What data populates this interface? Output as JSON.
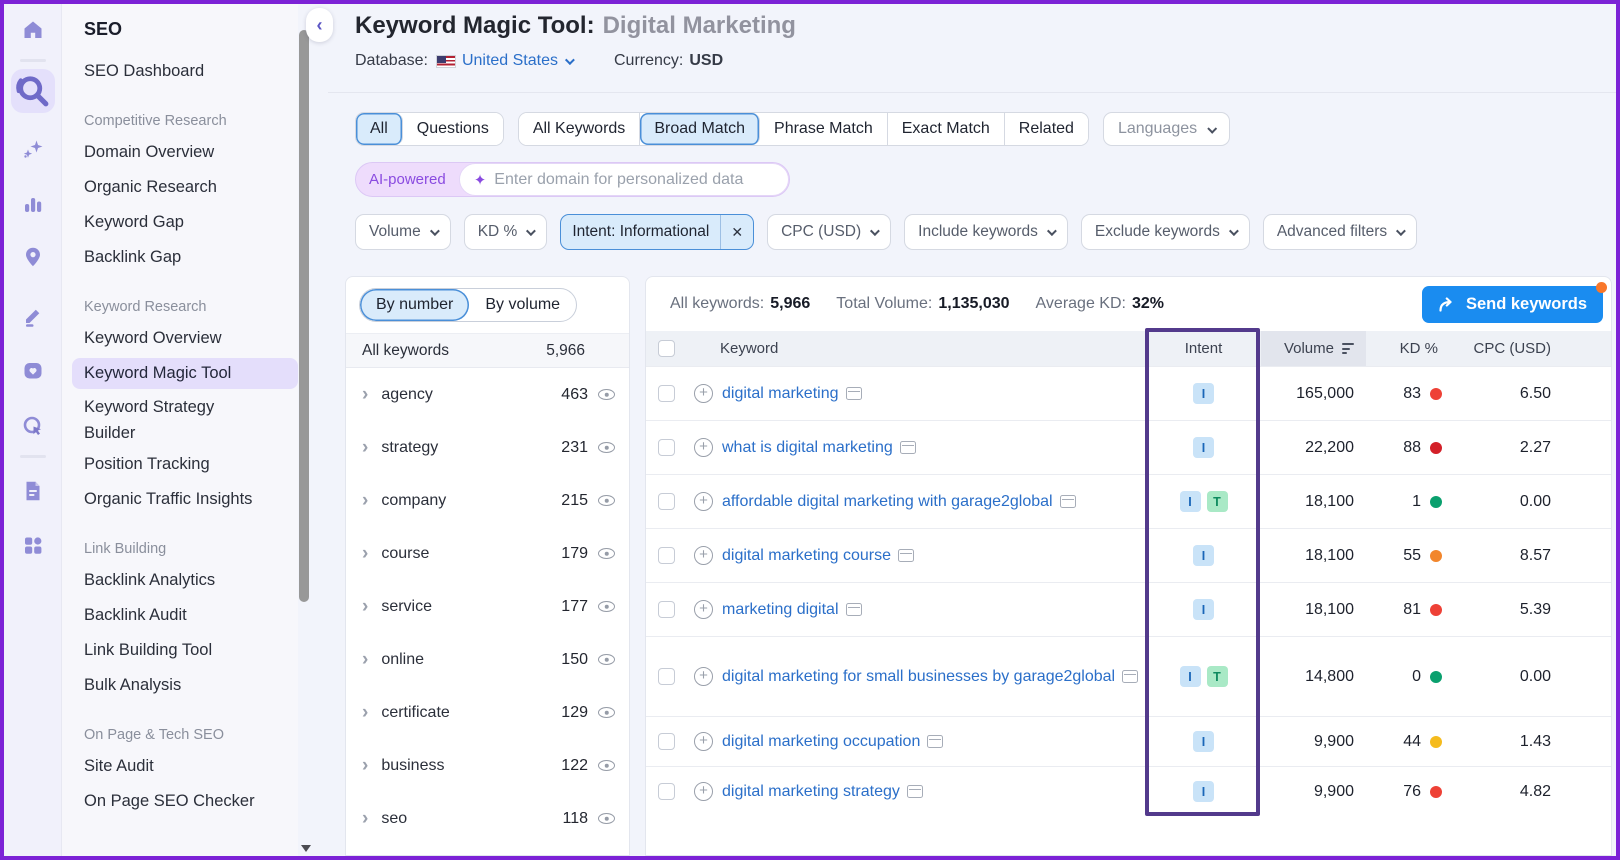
{
  "icons": {
    "plus": "+",
    "close": "✕",
    "chevron_right": "›",
    "chevron_left": "‹",
    "sparkle": "✦"
  },
  "rail": {
    "icons": [
      "home-icon",
      "seo-search-icon",
      "ai-sparkles-icon",
      "analytics-bars-icon",
      "local-pin-icon",
      "content-pencil-icon",
      "social-heart-icon",
      "advertising-target-icon",
      "reports-file-icon",
      "apps-grid-icon"
    ]
  },
  "sidebar": {
    "heading": "SEO",
    "dashboard": "SEO Dashboard",
    "sections": [
      {
        "title": "Competitive Research",
        "items": [
          "Domain Overview",
          "Organic Research",
          "Keyword Gap",
          "Backlink Gap"
        ]
      },
      {
        "title": "Keyword Research",
        "items": [
          "Keyword Overview",
          "Keyword Magic Tool",
          "Keyword Strategy Builder",
          "Position Tracking",
          "Organic Traffic Insights"
        ]
      },
      {
        "title": "Link Building",
        "items": [
          "Backlink Analytics",
          "Backlink Audit",
          "Link Building Tool",
          "Bulk Analysis"
        ]
      },
      {
        "title": "On Page & Tech SEO",
        "items": [
          "Site Audit",
          "On Page SEO Checker"
        ]
      }
    ],
    "active_item": "Keyword Magic Tool"
  },
  "header": {
    "title": "Keyword Magic Tool:",
    "query": "Digital Marketing",
    "database_label": "Database:",
    "database_value": "United States",
    "currency_label": "Currency:",
    "currency_value": "USD"
  },
  "tabs": {
    "scope": [
      "All",
      "Questions"
    ],
    "scope_active": "All",
    "match": [
      "All Keywords",
      "Broad Match",
      "Phrase Match",
      "Exact Match",
      "Related"
    ],
    "match_active": "Broad Match",
    "languages": "Languages"
  },
  "ai_bar": {
    "badge": "AI-powered",
    "placeholder": "Enter domain for personalized data"
  },
  "filters": {
    "volume": "Volume",
    "kd": "KD %",
    "intent_chip": "Intent: Informational",
    "cpc": "CPC (USD)",
    "include": "Include keywords",
    "exclude": "Exclude keywords",
    "advanced": "Advanced filters"
  },
  "groups_panel": {
    "toggle": [
      "By number",
      "By volume"
    ],
    "toggle_active": "By number",
    "header": {
      "label": "All keywords",
      "count": "5,966"
    },
    "items": [
      {
        "name": "agency",
        "count": "463"
      },
      {
        "name": "strategy",
        "count": "231"
      },
      {
        "name": "company",
        "count": "215"
      },
      {
        "name": "course",
        "count": "179"
      },
      {
        "name": "service",
        "count": "177"
      },
      {
        "name": "online",
        "count": "150"
      },
      {
        "name": "certificate",
        "count": "129"
      },
      {
        "name": "business",
        "count": "122"
      },
      {
        "name": "seo",
        "count": "118"
      }
    ]
  },
  "summary": {
    "all_keywords_label": "All keywords:",
    "all_keywords": "5,966",
    "total_volume_label": "Total Volume:",
    "total_volume": "1,135,030",
    "avg_kd_label": "Average KD:",
    "avg_kd": "32%",
    "send_button": "Send keywords"
  },
  "table": {
    "columns": {
      "keyword": "Keyword",
      "intent": "Intent",
      "volume": "Volume",
      "kd": "KD %",
      "cpc": "CPC (USD)"
    },
    "rows": [
      {
        "keyword": "digital marketing",
        "intents": [
          "I"
        ],
        "volume": "165,000",
        "kd": "83",
        "kd_color": "#ee4136",
        "cpc": "6.50"
      },
      {
        "keyword": "what is digital marketing",
        "intents": [
          "I"
        ],
        "volume": "22,200",
        "kd": "88",
        "kd_color": "#d32029",
        "cpc": "2.27"
      },
      {
        "keyword": "affordable digital marketing with garage2global",
        "intents": [
          "I",
          "T"
        ],
        "volume": "18,100",
        "kd": "1",
        "kd_color": "#0aa06e",
        "cpc": "0.00"
      },
      {
        "keyword": "digital marketing course",
        "intents": [
          "I"
        ],
        "volume": "18,100",
        "kd": "55",
        "kd_color": "#f2862c",
        "cpc": "8.57"
      },
      {
        "keyword": "marketing digital",
        "intents": [
          "I"
        ],
        "volume": "18,100",
        "kd": "81",
        "kd_color": "#ee4136",
        "cpc": "5.39"
      },
      {
        "keyword": "digital marketing for small businesses by garage2global",
        "intents": [
          "I",
          "T"
        ],
        "volume": "14,800",
        "kd": "0",
        "kd_color": "#0aa06e",
        "cpc": "0.00"
      },
      {
        "keyword": "digital marketing occupation",
        "intents": [
          "I"
        ],
        "volume": "9,900",
        "kd": "44",
        "kd_color": "#f5bb1d",
        "cpc": "1.43"
      },
      {
        "keyword": "digital marketing strategy",
        "intents": [
          "I"
        ],
        "volume": "9,900",
        "kd": "76",
        "kd_color": "#ee4136",
        "cpc": "4.82"
      }
    ]
  },
  "annotation_color": "#533a8c"
}
